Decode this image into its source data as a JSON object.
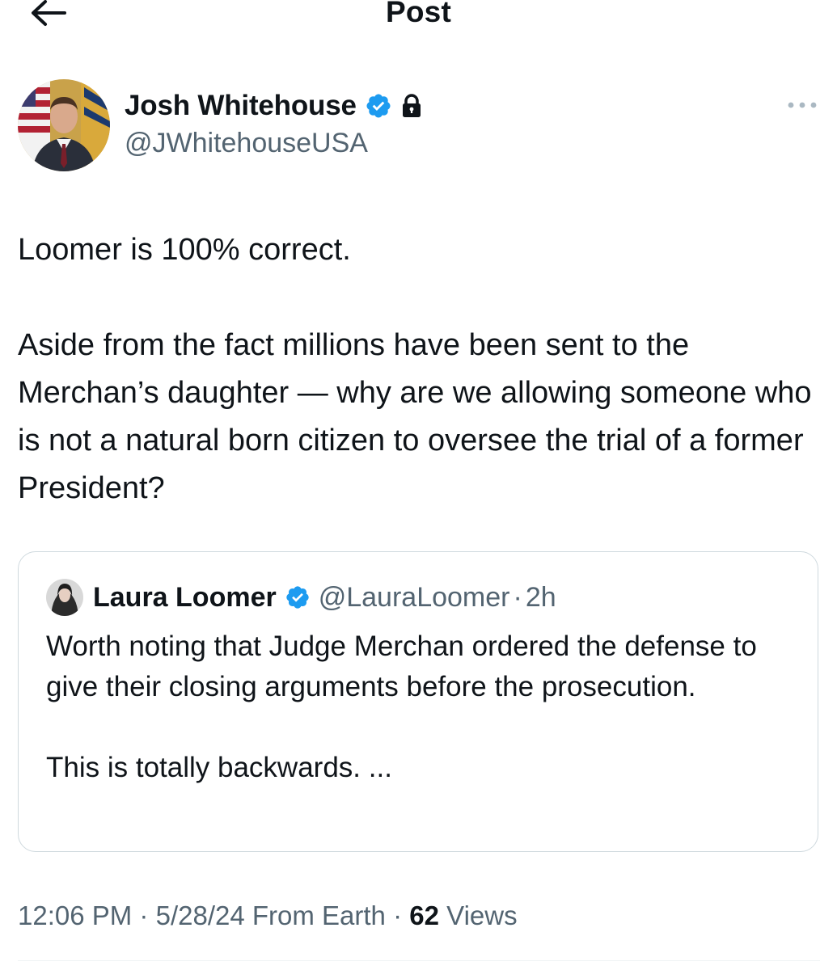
{
  "header": {
    "title": "Post"
  },
  "post": {
    "author": {
      "name": "Josh Whitehouse",
      "handle": "@JWhitehouseUSA",
      "verified": true,
      "protected": true
    },
    "paragraphs": [
      "Loomer is 100% correct.",
      "Aside from the fact millions have been sent to the Merchan’s daughter — why are we allowing someone who is not a natural born citizen to oversee the trial of a former President?"
    ],
    "quote": {
      "name": "Laura Loomer",
      "handle": "@LauraLoomer",
      "separator": "·",
      "time": "2h",
      "paragraphs": [
        "Worth noting that Judge Merchan ordered the defense to give their closing arguments before the prosecution.",
        "This is totally backwards. ..."
      ]
    },
    "meta": {
      "time": "12:06 PM",
      "sep1": "·",
      "date": "5/28/24",
      "source": "From Earth",
      "sep2": "·",
      "views_count": "62",
      "views_label": "Views"
    }
  },
  "colors": {
    "text": "#0f1419",
    "secondary": "#536471",
    "verified_blue": "#1d9bf0",
    "border": "#cfd9de"
  },
  "icons": [
    "arrow-left-icon",
    "verified-badge-icon",
    "lock-icon",
    "more-horizontal-icon"
  ]
}
